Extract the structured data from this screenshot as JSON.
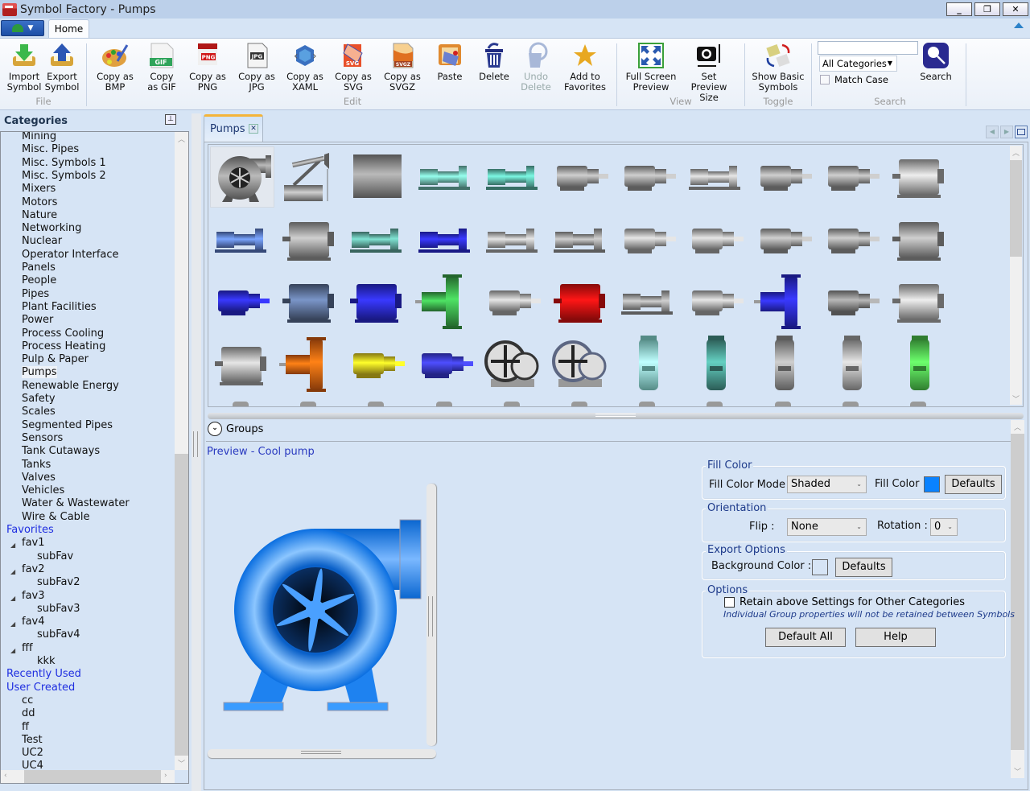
{
  "window": {
    "title": "Symbol Factory - Pumps"
  },
  "window_controls": {
    "minimize": "_",
    "restore": "❐",
    "close": "✕"
  },
  "ribbon": {
    "tabs": [
      {
        "label": "Home",
        "active": true
      }
    ],
    "groups": {
      "file": {
        "label": "File",
        "buttons": [
          {
            "label": "Import Symbol",
            "line1": "Import",
            "line2": "Symbol",
            "icon": "import-icon"
          },
          {
            "label": "Export Symbol",
            "line1": "Export",
            "line2": "Symbol",
            "icon": "export-icon"
          }
        ]
      },
      "edit": {
        "label": "Edit",
        "buttons": [
          {
            "line1": "Copy as",
            "line2": "BMP",
            "icon": "palette-icon",
            "enabled": true
          },
          {
            "line1": "Copy",
            "line2": "as GIF",
            "icon": "gif-file-icon",
            "enabled": true
          },
          {
            "line1": "Copy as",
            "line2": "PNG",
            "icon": "png-file-icon",
            "enabled": true
          },
          {
            "line1": "Copy as",
            "line2": "JPG",
            "icon": "jpg-file-icon",
            "enabled": true
          },
          {
            "line1": "Copy as",
            "line2": "XAML",
            "icon": "xaml-icon",
            "enabled": true
          },
          {
            "line1": "Copy as",
            "line2": "SVG",
            "icon": "svg-file-icon",
            "enabled": true
          },
          {
            "line1": "Copy as",
            "line2": "SVGZ",
            "icon": "svgz-file-icon",
            "enabled": true
          },
          {
            "line1": "Paste",
            "line2": "",
            "icon": "paste-icon",
            "enabled": true
          },
          {
            "line1": "Delete",
            "line2": "",
            "icon": "trash-icon",
            "enabled": true
          },
          {
            "line1": "Undo",
            "line2": "Delete",
            "icon": "undo-delete-icon",
            "enabled": false
          },
          {
            "line1": "Add to",
            "line2": "Favorites",
            "icon": "star-icon",
            "enabled": true
          }
        ]
      },
      "view": {
        "label": "View",
        "buttons": [
          {
            "line1": "Full Screen",
            "line2": "Preview",
            "icon": "fullscreen-icon"
          },
          {
            "line1": "Set",
            "line2": "Preview Size",
            "icon": "camera-resize-icon"
          }
        ]
      },
      "toggle": {
        "label": "Toggle",
        "buttons": [
          {
            "line1": "Show Basic",
            "line2": "Symbols",
            "icon": "swap-symbols-icon"
          }
        ]
      },
      "search": {
        "label": "Search",
        "input_value": "",
        "category_select": "All Categories",
        "match_case_label": "Match Case",
        "match_case_checked": false,
        "button_label": "Search"
      }
    }
  },
  "categories": {
    "header": "Categories",
    "items": [
      "Mining",
      "Misc. Pipes",
      "Misc. Symbols 1",
      "Misc. Symbols 2",
      "Mixers",
      "Motors",
      "Nature",
      "Networking",
      "Nuclear",
      "Operator Interface",
      "Panels",
      "People",
      "Pipes",
      "Plant Facilities",
      "Power",
      "Process Cooling",
      "Process Heating",
      "Pulp & Paper",
      "Pumps",
      "Renewable Energy",
      "Safety",
      "Scales",
      "Segmented Pipes",
      "Sensors",
      "Tank Cutaways",
      "Tanks",
      "Valves",
      "Vehicles",
      "Water & Wastewater",
      "Wire & Cable"
    ],
    "selected": "Pumps",
    "favorites_label": "Favorites",
    "favorites": [
      {
        "name": "fav1",
        "children": [
          "subFav"
        ]
      },
      {
        "name": "fav2",
        "children": [
          "subFav2"
        ]
      },
      {
        "name": "fav3",
        "children": [
          "subFav3"
        ]
      },
      {
        "name": "fav4",
        "children": [
          "subFav4"
        ]
      },
      {
        "name": "fff",
        "children": [
          "kkk"
        ]
      }
    ],
    "recently_used_label": "Recently Used",
    "user_created_label": "User Created",
    "user_created": [
      "cc",
      "dd",
      "ff",
      "Test",
      "UC2",
      "UC4"
    ]
  },
  "document": {
    "tab_label": "Pumps",
    "symbols": [
      {
        "row": 0,
        "col": 0,
        "color": "#8a8a8a",
        "kind": "centrifugal",
        "selected": true
      },
      {
        "row": 0,
        "col": 1,
        "color": "#9a9a9a",
        "kind": "pumpjack"
      },
      {
        "row": 0,
        "col": 2,
        "color": "#8a8a8a",
        "kind": "large-gray"
      },
      {
        "row": 0,
        "col": 3,
        "color": "#6fbdb0",
        "kind": "horizontal"
      },
      {
        "row": 0,
        "col": 4,
        "color": "#5cb8a8",
        "kind": "horizontal"
      },
      {
        "row": 0,
        "col": 5,
        "color": "#999999",
        "kind": "motor"
      },
      {
        "row": 0,
        "col": 6,
        "color": "#999999",
        "kind": "motor"
      },
      {
        "row": 0,
        "col": 7,
        "color": "#aaaaaa",
        "kind": "horizontal"
      },
      {
        "row": 0,
        "col": 8,
        "color": "#999999",
        "kind": "motor"
      },
      {
        "row": 0,
        "col": 9,
        "color": "#999999",
        "kind": "motor"
      },
      {
        "row": 0,
        "col": 10,
        "color": "#b0b0b0",
        "kind": "box"
      },
      {
        "row": 1,
        "col": 0,
        "color": "#5a7ac8",
        "kind": "horizontal"
      },
      {
        "row": 1,
        "col": 1,
        "color": "#999999",
        "kind": "box"
      },
      {
        "row": 1,
        "col": 2,
        "color": "#5fa89c",
        "kind": "horizontal"
      },
      {
        "row": 1,
        "col": 3,
        "color": "#2a2ae0",
        "kind": "horizontal"
      },
      {
        "row": 1,
        "col": 4,
        "color": "#aaaaaa",
        "kind": "horizontal"
      },
      {
        "row": 1,
        "col": 5,
        "color": "#999999",
        "kind": "horizontal"
      },
      {
        "row": 1,
        "col": 6,
        "color": "#aaaaaa",
        "kind": "motor"
      },
      {
        "row": 1,
        "col": 7,
        "color": "#aaaaaa",
        "kind": "motor"
      },
      {
        "row": 1,
        "col": 8,
        "color": "#999999",
        "kind": "motor"
      },
      {
        "row": 1,
        "col": 9,
        "color": "#999999",
        "kind": "motor"
      },
      {
        "row": 1,
        "col": 10,
        "color": "#999999",
        "kind": "box"
      },
      {
        "row": 2,
        "col": 0,
        "color": "#2a2ad8",
        "kind": "motor"
      },
      {
        "row": 2,
        "col": 1,
        "color": "#5a6e94",
        "kind": "box"
      },
      {
        "row": 2,
        "col": 2,
        "color": "#2a2ad8",
        "kind": "box"
      },
      {
        "row": 2,
        "col": 3,
        "color": "#3aa84a",
        "kind": "vertical"
      },
      {
        "row": 2,
        "col": 4,
        "color": "#aaaaaa",
        "kind": "motor"
      },
      {
        "row": 2,
        "col": 5,
        "color": "#e01010",
        "kind": "box"
      },
      {
        "row": 2,
        "col": 6,
        "color": "#999999",
        "kind": "horizontal"
      },
      {
        "row": 2,
        "col": 7,
        "color": "#aaaaaa",
        "kind": "motor"
      },
      {
        "row": 2,
        "col": 8,
        "color": "#2a2ad8",
        "kind": "vertical"
      },
      {
        "row": 2,
        "col": 9,
        "color": "#888888",
        "kind": "motor"
      },
      {
        "row": 2,
        "col": 10,
        "color": "#b0b0b0",
        "kind": "box"
      },
      {
        "row": 3,
        "col": 0,
        "color": "#aaaaaa",
        "kind": "box"
      },
      {
        "row": 3,
        "col": 1,
        "color": "#e06010",
        "kind": "vertical"
      },
      {
        "row": 3,
        "col": 2,
        "color": "#e0c820",
        "kind": "motor"
      },
      {
        "row": 3,
        "col": 3,
        "color": "#3a3ae0",
        "kind": "motor"
      },
      {
        "row": 3,
        "col": 4,
        "color": "#555555",
        "kind": "wheel"
      },
      {
        "row": 3,
        "col": 5,
        "color": "#9aaad8",
        "kind": "wheel"
      },
      {
        "row": 3,
        "col": 6,
        "color": "#8ee8e0",
        "kind": "tall"
      },
      {
        "row": 3,
        "col": 7,
        "color": "#4a9a90",
        "kind": "tall"
      },
      {
        "row": 3,
        "col": 8,
        "color": "#999999",
        "kind": "tall"
      },
      {
        "row": 3,
        "col": 9,
        "color": "#aaaaaa",
        "kind": "tall"
      },
      {
        "row": 3,
        "col": 10,
        "color": "#50d050",
        "kind": "tall"
      }
    ],
    "groups_label": "Groups",
    "preview_title": "Preview - Cool pump",
    "preview_color": "#1e88ff"
  },
  "properties": {
    "fill_color": {
      "legend": "Fill Color",
      "mode_label": "Fill Color Mode",
      "mode_value": "Shaded",
      "color_label": "Fill Color",
      "color_value": "#0a82ff",
      "defaults_label": "Defaults"
    },
    "orientation": {
      "legend": "Orientation",
      "flip_label": "Flip :",
      "flip_value": "None",
      "rotation_label": "Rotation :",
      "rotation_value": "0"
    },
    "export_options": {
      "legend": "Export Options",
      "bg_label": "Background Color :",
      "bg_value": "#d6e4f5",
      "defaults_label": "Defaults"
    },
    "options": {
      "legend": "Options",
      "retain_label": "Retain above Settings for Other Categories",
      "retain_checked": false,
      "note": "Individual Group properties will not be retained between Symbols",
      "default_all_label": "Default All",
      "help_label": "Help"
    }
  }
}
